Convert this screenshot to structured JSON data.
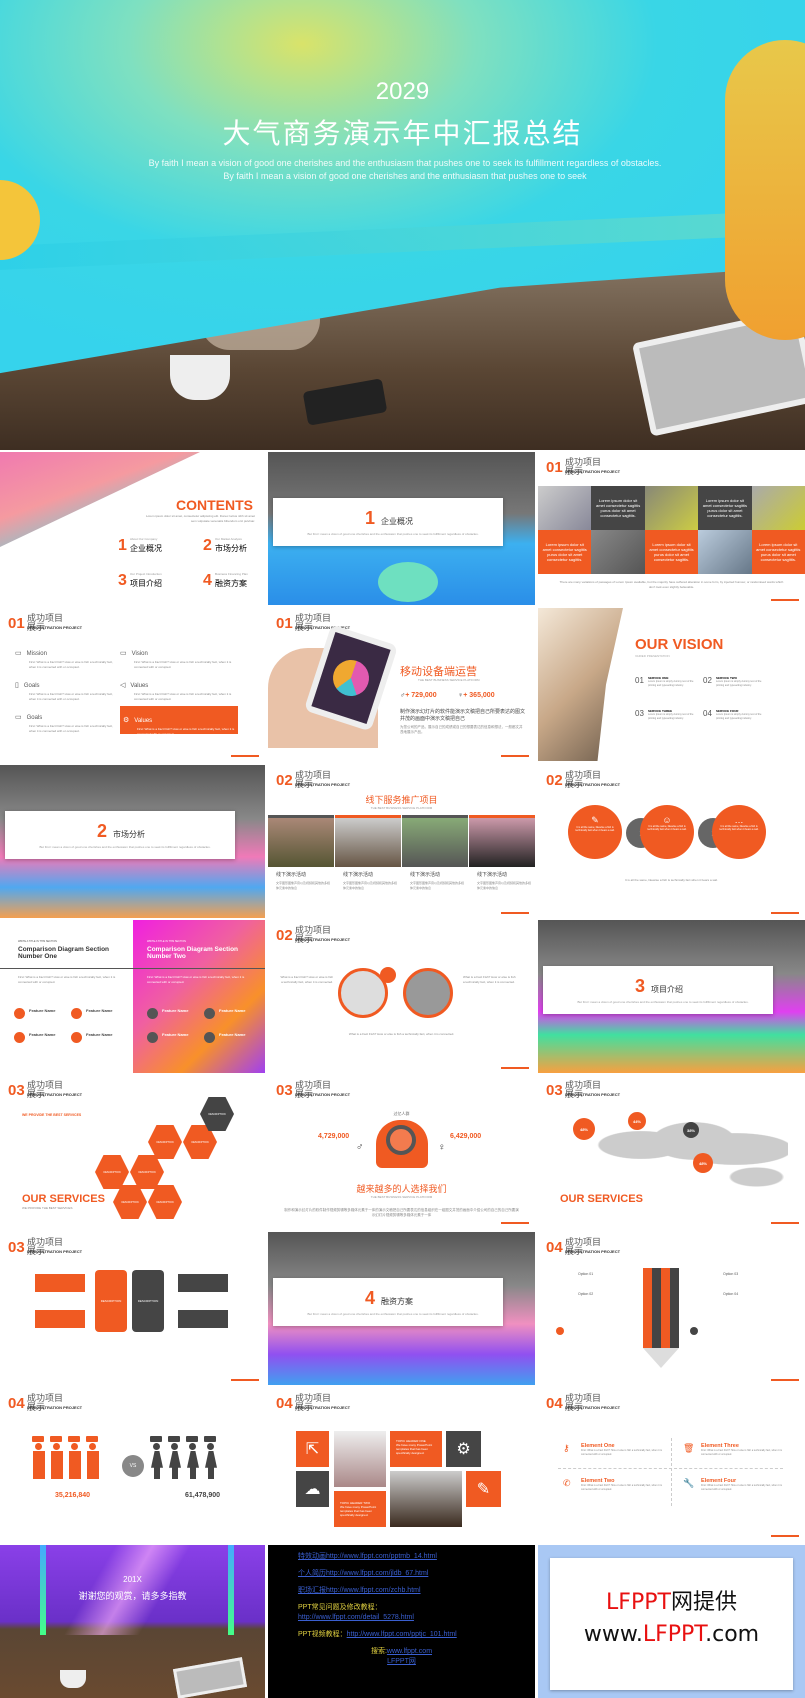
{
  "hero": {
    "year": "2029",
    "title": "大气商务演示年中汇报总结",
    "subtitle": "By faith I mean a vision of good one cherishes and the enthusiasm that pushes one to seek its fulfillment regardless of obstacles. By faith I mean a vision of good one cherishes and the enthusiasm that pushes one to seek"
  },
  "header": {
    "title": "成功项目展示",
    "sub": "DEMONSTRATION PROJECT"
  },
  "colors": {
    "accent": "#f05a22",
    "dark": "#454545"
  },
  "contents": {
    "title": "CONTENTS",
    "desc": "Lorem ipsum dolor sit amet, consectetur adipiscing elit. Donec luctus nibh sit amet sem vulputate venenatis bibendum orci pulvinar.",
    "items": [
      {
        "num": "1",
        "en": "About Our Company",
        "label": "企业概况"
      },
      {
        "num": "2",
        "en": "Our Market Analysis",
        "label": "市场分析"
      },
      {
        "num": "3",
        "en": "Our Project Introduction",
        "label": "项目介绍"
      },
      {
        "num": "4",
        "en": "Business Financing Plan",
        "label": "融资方案"
      }
    ]
  },
  "sections": [
    {
      "num": "1",
      "label": "企业概况",
      "en": "About Our Company"
    },
    {
      "num": "2",
      "label": "市场分析",
      "en": "About Our Company"
    },
    {
      "num": "3",
      "label": "项目介绍",
      "en": "About Our Company"
    },
    {
      "num": "4",
      "label": "融资方案",
      "en": "About Our Company"
    }
  ],
  "section_desc": "But first I mean a vision of good one cherishes and the enthusiasm that pushes one to seek its fulfillment regardless of obstacles.",
  "factory": {
    "num": "01",
    "desc_title": "Description",
    "desc_text": "Lorem ipsum dolor sit amet consectetur sagittis purus dolor sit amet consectetur sagittis.",
    "footer": "There are many variations of passages of Lorem Ipsum available, but the majority have suffered alteration in some form, by injected humour, or randomised words which don't look even slightly believable."
  },
  "mission": {
    "num": "01",
    "items": [
      {
        "icon": "video-icon",
        "label": "Mission"
      },
      {
        "icon": "monitor-icon",
        "label": "Vision"
      },
      {
        "icon": "tablet-icon",
        "label": "Goals"
      },
      {
        "icon": "speaker-icon",
        "label": "Values"
      },
      {
        "icon": "laptop-icon",
        "label": "Goals"
      },
      {
        "icon": "gear-icon",
        "label": "Values",
        "active": true
      }
    ],
    "text": "First: What is a Fact Fish? How or else is fish a technically fact, when it is connected with or occupied."
  },
  "mobile": {
    "num": "01",
    "title": "移动设备端运营",
    "sub": "THE BEST BUSINESS SERVICE PLATFORM",
    "male": "+ 729,000",
    "female": "+ 365,000",
    "lead": "制作演示幻灯片的软件能演示文稿把自己所要表达的图文并茂的画面中演示文稿把自己",
    "body": "为您公司的产品，展示自己的成绩或自己的想要表达的信息和想法，一般都文并茂地展示产品。"
  },
  "vision": {
    "title": "OUR VISION",
    "sub": "VARIED PRESENTATION",
    "items": [
      {
        "num": "01",
        "label": "SERVICE ONE"
      },
      {
        "num": "02",
        "label": "SERVICE TWO"
      },
      {
        "num": "03",
        "label": "SERVICE THREE"
      },
      {
        "num": "04",
        "label": "SERVICE FOUR"
      }
    ],
    "text": "Lorem Ipsum is simply dummy text of the printing and typesetting industry."
  },
  "offline": {
    "num": "02",
    "title": "线下服务推广项目",
    "sub": "THE BEST BUSINESS SERVICE PLATFORM",
    "items": [
      "线下演示活动",
      "线下演示活动",
      "线下演示活动",
      "线下演示活动"
    ],
    "text": "文字图形图像声音以及视频和其他的多媒体元素中的信息"
  },
  "circles": {
    "num": "02",
    "text": "It is all the same, likewise a fish is technically fact when it bears a sail.",
    "icons": [
      "edit-icon",
      "users-icon",
      "chat-icon"
    ]
  },
  "comparison": {
    "kicker": "WRITE A TITLE IN THIS SECTION",
    "one": "Comparison Diagram Section Number One",
    "two": "Comparison Diagram Section Number Two",
    "feature": "Feature Name",
    "text": "First: What is a Fact Fish? How or else is fish a technically fact, when it is connected with or occupied."
  },
  "laptops": {
    "num": "02",
    "text": "What is a Fact Fish? How or else is fish a technically fact, when it is connected."
  },
  "hex": {
    "num": "03",
    "title": "OUR SERVICES",
    "sub": "WE PROVIDE THE BEST SERVICES",
    "heading": "WE PROVIDE THE BEST SERVICES",
    "cell": "DESCRIPTION"
  },
  "people3": {
    "num": "03",
    "top": "过亿人群",
    "male": "4,729,000",
    "female": "6,429,000",
    "title": "越来越多的人选择我们",
    "sub": "THE BEST BUSINESS SERVICE PLATFORM",
    "body": "制作和演示幻灯片的软件制作视频剪辑等多媒体元素于一体的演示文稿把自己所要表达的信息组织在一组图文并茂的画面中介绍公司的自己的自己所要演示幻灯片视频剪辑等多媒体元素于一体"
  },
  "map": {
    "num": "03",
    "title": "OUR SERVICES",
    "values": [
      "48%",
      "44%",
      "38%",
      "48%"
    ]
  },
  "flow": {
    "num": "03",
    "labels": [
      "DESCRIPTION",
      "DESCRIPTION"
    ]
  },
  "pencil": {
    "num": "04",
    "options": [
      "Option 01",
      "Option 02",
      "Option 03",
      "Option 04"
    ]
  },
  "people4": {
    "num": "04",
    "male": "35,216,840",
    "female": "61,478,900",
    "vs": "VS"
  },
  "tiles": {
    "num": "04",
    "h1": "TOPIC HEADER ONE",
    "h2": "TOPIC HEADER TWO",
    "text": "We have many PowerPoint templates that has been specifically designed."
  },
  "elements": {
    "num": "04",
    "items": [
      {
        "icon": "key-icon",
        "label": "Element One"
      },
      {
        "icon": "trash-icon",
        "label": "Element Three"
      },
      {
        "icon": "phone-icon",
        "label": "Element Two"
      },
      {
        "icon": "wrench-icon",
        "label": "Element Four"
      }
    ]
  },
  "thanks": {
    "year": "201X",
    "title": "谢谢您的观赏，请多多指教"
  },
  "links": [
    {
      "label": "特效动画",
      "url": "http://www.lfppt.com/pptmb_14.html"
    },
    {
      "label": "个人简历",
      "url": "http://www.lfppt.com/jldb_67.html"
    },
    {
      "label": "职场汇报",
      "url": "http://www.lfppt.com/zchb.html"
    },
    {
      "label": "PPT常见问题及修改教程：",
      "url": "http://www.lfppt.com/detail_5278.html"
    },
    {
      "label": "PPT视频教程：",
      "url": "http://www.lfppt.com/pptjc_101.html"
    }
  ],
  "search": {
    "label": "搜索:",
    "url": "www.lfppt.com",
    "name": "LFPPT网"
  },
  "brand": {
    "line1_red": "LFPPT",
    "line1_black": "网提供",
    "line2_a": "www.",
    "line2_red": "LFPPT",
    "line2_b": ".com"
  }
}
